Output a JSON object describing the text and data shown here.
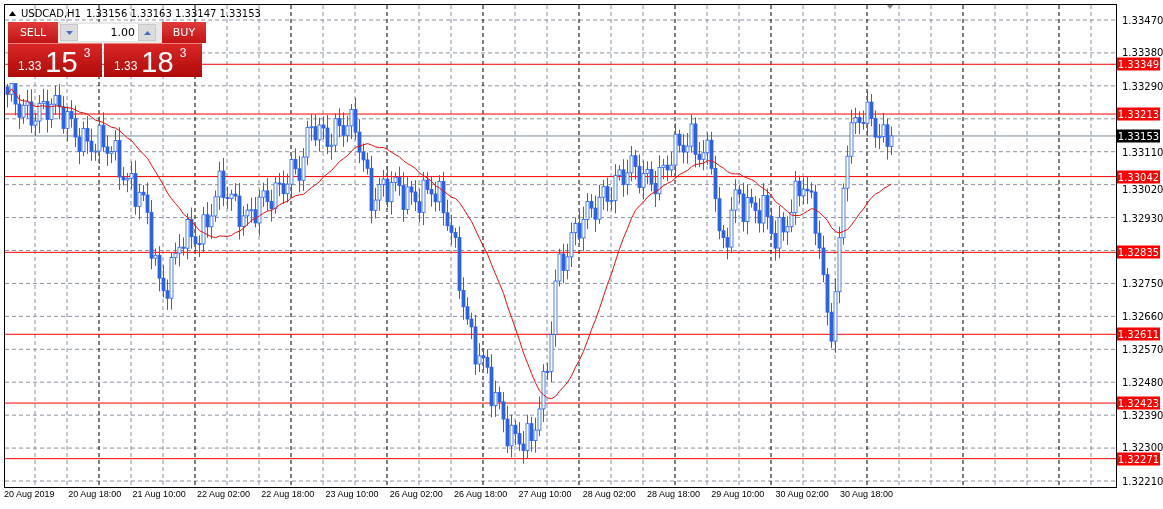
{
  "header": {
    "symbol": "USDCAD,H1",
    "quote": "1.33156 1.33163 1.33147 1.33153"
  },
  "trade_panel": {
    "sell_label": "SELL",
    "buy_label": "BUY",
    "lot": "1.00",
    "sell_price": {
      "prefix": "1.33",
      "big": "15",
      "pip": "3"
    },
    "buy_price": {
      "prefix": "1.33",
      "big": "18",
      "pip": "3"
    }
  },
  "price_axis": [
    "1.33470",
    "1.33380",
    "1.33290",
    "1.33110",
    "1.33020",
    "1.32930",
    "1.32750",
    "1.32660",
    "1.32570",
    "1.32480",
    "1.32390",
    "1.32300",
    "1.32210"
  ],
  "levels": [
    {
      "price": "1.33349"
    },
    {
      "price": "1.33213"
    },
    {
      "price": "1.33042"
    },
    {
      "price": "1.32835"
    },
    {
      "price": "1.32611"
    },
    {
      "price": "1.32423"
    },
    {
      "price": "1.32271"
    }
  ],
  "current_price": "1.33153",
  "time_axis": [
    "20 Aug 2019",
    "20 Aug 18:00",
    "21 Aug 10:00",
    "22 Aug 02:00",
    "22 Aug 18:00",
    "23 Aug 10:00",
    "26 Aug 02:00",
    "26 Aug 18:00",
    "27 Aug 10:00",
    "28 Aug 02:00",
    "28 Aug 18:00",
    "29 Aug 10:00",
    "30 Aug 02:00",
    "30 Aug 18:00"
  ]
}
